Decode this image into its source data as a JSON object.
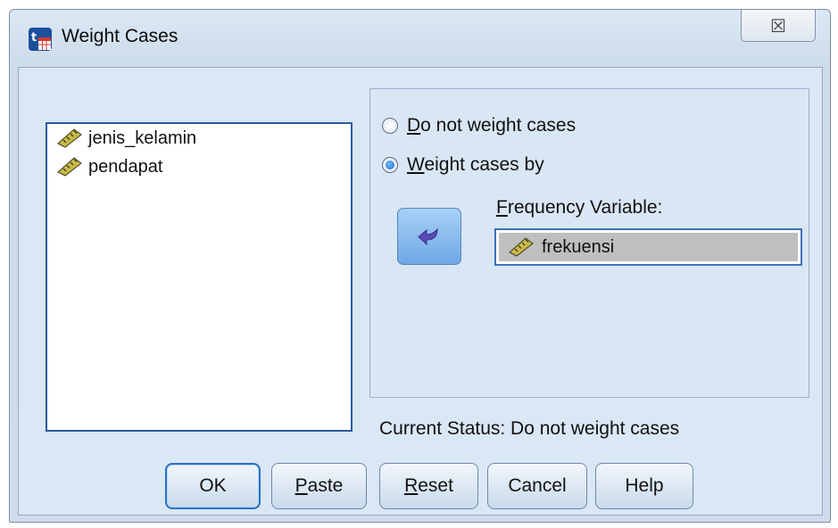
{
  "window": {
    "title": "Weight Cases",
    "close_symbol": "☒"
  },
  "variables": [
    {
      "label": "jenis_kelamin",
      "icon": "ruler-icon"
    },
    {
      "label": "pendapat",
      "icon": "ruler-icon"
    }
  ],
  "options": {
    "no_weight": {
      "accel": "D",
      "rest": "o not weight cases",
      "checked": false
    },
    "weight_by": {
      "accel": "W",
      "rest": "eight cases by",
      "checked": true
    }
  },
  "frequency": {
    "label_accel": "F",
    "label_rest": "requency Variable:",
    "value": "frekuensi"
  },
  "status": {
    "text": "Current Status: Do not weight cases"
  },
  "buttons": {
    "ok": {
      "label": "OK"
    },
    "paste": {
      "accel": "P",
      "rest": "aste"
    },
    "reset": {
      "accel": "R",
      "rest": "eset"
    },
    "cancel": {
      "label": "Cancel"
    },
    "help": {
      "label": "Help"
    }
  },
  "colors": {
    "dialog_bg": "#dae7f5",
    "selection_bg": "#bfbfbf",
    "focus_border": "#2a5aa0"
  }
}
